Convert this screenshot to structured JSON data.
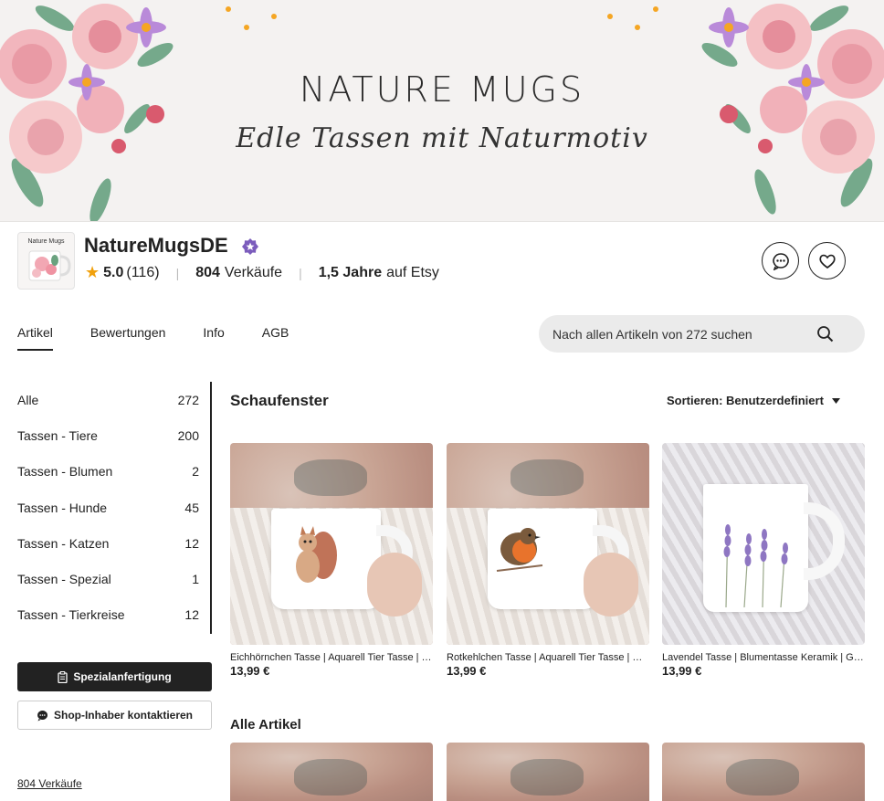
{
  "banner": {
    "title": "NATURE MUGS",
    "subtitle": "Edle Tassen mit Naturmotiv"
  },
  "shop": {
    "logo_text": "Nature Mugs",
    "name": "NatureMugsDE",
    "rating": "5.0",
    "reviews": "(116)",
    "sales_count": "804",
    "sales_label": "Verkäufe",
    "years": "1,5 Jahre",
    "years_label": "auf Etsy"
  },
  "tabs": [
    "Artikel",
    "Bewertungen",
    "Info",
    "AGB"
  ],
  "search": {
    "placeholder": "Nach allen Artikeln von 272 suchen"
  },
  "sidebar": {
    "items": [
      {
        "label": "Alle",
        "count": "272"
      },
      {
        "label": "Tassen - Tiere",
        "count": "200"
      },
      {
        "label": "Tassen - Blumen",
        "count": "2"
      },
      {
        "label": "Tassen - Hunde",
        "count": "45"
      },
      {
        "label": "Tassen - Katzen",
        "count": "12"
      },
      {
        "label": "Tassen - Spezial",
        "count": "1"
      },
      {
        "label": "Tassen - Tierkreise",
        "count": "12"
      }
    ],
    "custom_button": "Spezialanfertigung",
    "contact_button": "Shop-Inhaber kontaktieren",
    "sales_link": "804 Verkäufe"
  },
  "showcase": {
    "title": "Schaufenster",
    "sort_label": "Sortieren: Benutzerdefiniert",
    "items": [
      {
        "caption": "Eichhörnchen Tasse | Aquarell Tier Tasse | Geschenk",
        "price": "13,99 €"
      },
      {
        "caption": "Rotkehlchen Tasse | Aquarell Tier Tasse | Geschenk",
        "price": "13,99 €"
      },
      {
        "caption": "Lavendel Tasse | Blumentasse Keramik | Geschenk",
        "price": "13,99 €"
      }
    ]
  },
  "all_items": {
    "title": "Alle Artikel"
  },
  "colors": {
    "accent": "#222222",
    "star": "#f1a10d",
    "badge": "#7b5cbc"
  }
}
